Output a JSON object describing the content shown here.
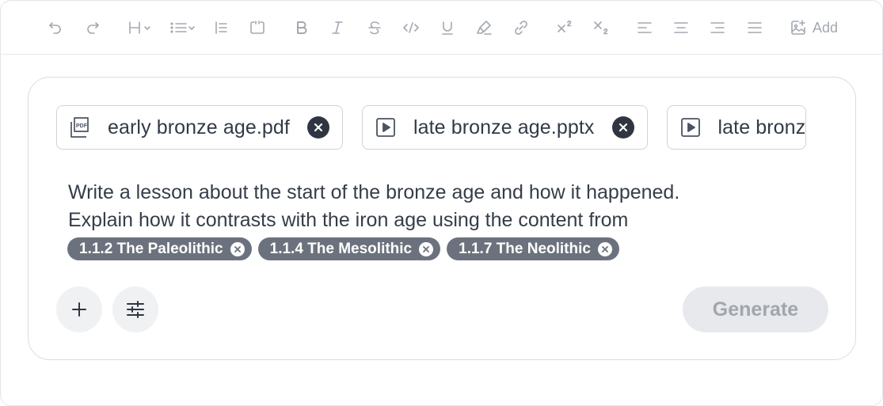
{
  "toolbar": {
    "items": [
      {
        "name": "undo-button",
        "icon": "undo-icon"
      },
      {
        "name": "redo-button",
        "icon": "redo-icon"
      },
      {
        "name": "heading-dropdown",
        "icon": "heading-icon"
      },
      {
        "name": "list-dropdown",
        "icon": "bullet-list-icon"
      },
      {
        "name": "blockquote-button",
        "icon": "blockquote-icon"
      },
      {
        "name": "code-block-button",
        "icon": "code-block-icon"
      },
      {
        "name": "bold-button",
        "icon": "bold-icon"
      },
      {
        "name": "italic-button",
        "icon": "italic-icon"
      },
      {
        "name": "strikethrough-button",
        "icon": "strikethrough-icon"
      },
      {
        "name": "code-button",
        "icon": "code-icon"
      },
      {
        "name": "underline-button",
        "icon": "underline-icon"
      },
      {
        "name": "highlight-button",
        "icon": "highlighter-icon"
      },
      {
        "name": "link-button",
        "icon": "link-icon"
      },
      {
        "name": "superscript-button",
        "icon": "superscript-icon"
      },
      {
        "name": "subscript-button",
        "icon": "subscript-icon"
      },
      {
        "name": "align-left-button",
        "icon": "align-left-icon"
      },
      {
        "name": "align-center-button",
        "icon": "align-center-icon"
      },
      {
        "name": "align-right-button",
        "icon": "align-right-icon"
      },
      {
        "name": "align-justify-button",
        "icon": "align-justify-icon"
      }
    ],
    "add_label": "Add"
  },
  "attachments": [
    {
      "name": "early bronze age.pdf",
      "icon": "pdf-file-icon"
    },
    {
      "name": "late bronze age.pptx",
      "icon": "presentation-file-icon"
    },
    {
      "name": "late bronz",
      "icon": "presentation-file-icon"
    }
  ],
  "prompt": {
    "line1": "Write a lesson about the start of the bronze age and how it happened.",
    "line2": "Explain how it contrasts with the iron age using the content from"
  },
  "references": [
    {
      "label": "1.1.2 The Paleolithic"
    },
    {
      "label": "1.1.4 The Mesolithic"
    },
    {
      "label": "1.1.7 The Neolithic"
    }
  ],
  "actions": {
    "add_icon": "plus-icon",
    "settings_icon": "sliders-icon",
    "generate_label": "Generate"
  },
  "colors": {
    "chip_dark": "#2f3642",
    "ref_chip": "#6c727d",
    "toolbar_icon": "#a3a8b0",
    "generate_bg": "#e7e9ec"
  }
}
